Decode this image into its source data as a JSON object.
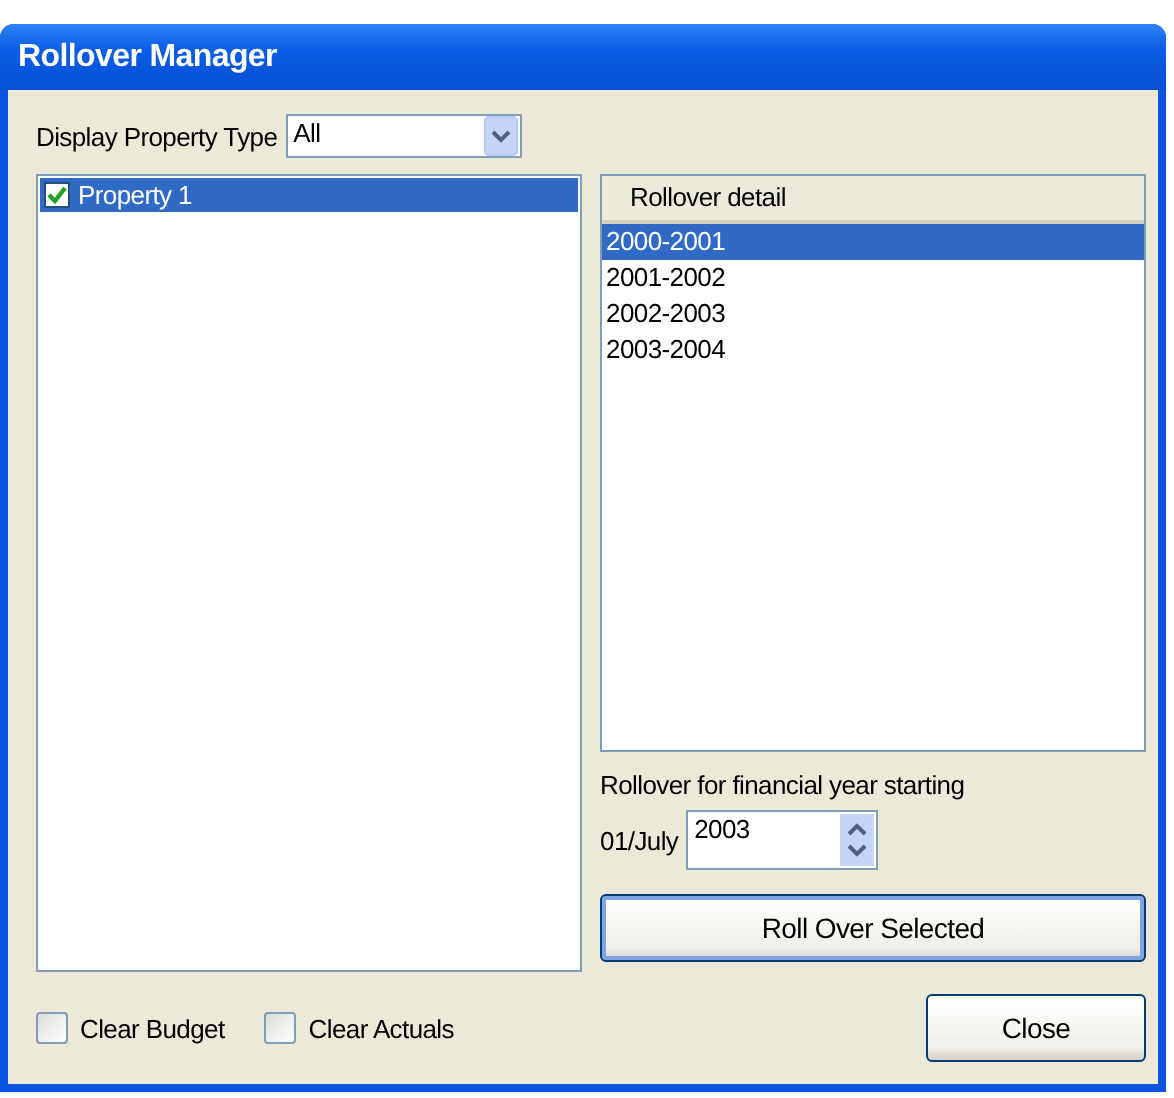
{
  "window": {
    "title": "Rollover Manager"
  },
  "filter": {
    "label": "Display Property Type",
    "value": "All"
  },
  "properties": [
    {
      "label": "Property 1",
      "checked": true,
      "selected": true
    }
  ],
  "rollover_detail": {
    "header": "Rollover detail",
    "rows": [
      {
        "label": "2000-2001",
        "selected": true
      },
      {
        "label": "2001-2002",
        "selected": false
      },
      {
        "label": "2002-2003",
        "selected": false
      },
      {
        "label": "2003-2004",
        "selected": false
      }
    ]
  },
  "financial_year": {
    "label": "Rollover for financial year starting",
    "prefix": "01/July",
    "value": "2003"
  },
  "roll_over_button": "Roll Over Selected",
  "options": [
    {
      "label": "Clear Budget",
      "checked": false
    },
    {
      "label": "Clear Actuals",
      "checked": false
    }
  ],
  "close_button": "Close"
}
